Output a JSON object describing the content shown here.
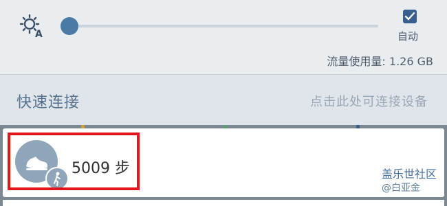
{
  "brightness": {
    "icon": "brightness-auto-icon",
    "level_percent": 2,
    "auto_label": "自动",
    "auto_checked": true
  },
  "data_usage": "流量使用量: 1.26 GB",
  "quick_connect": {
    "title": "快速连接",
    "hint": "点击此处可连接设备"
  },
  "card": {
    "icon": "shoe-icon",
    "badge_icon": "person-walking-icon",
    "steps": "5009 步"
  },
  "watermark": {
    "line1": "盖乐世社区",
    "line2": "@白亚金"
  },
  "colors": {
    "accent": "#4c7aa6",
    "highlight": "#e3151a"
  }
}
